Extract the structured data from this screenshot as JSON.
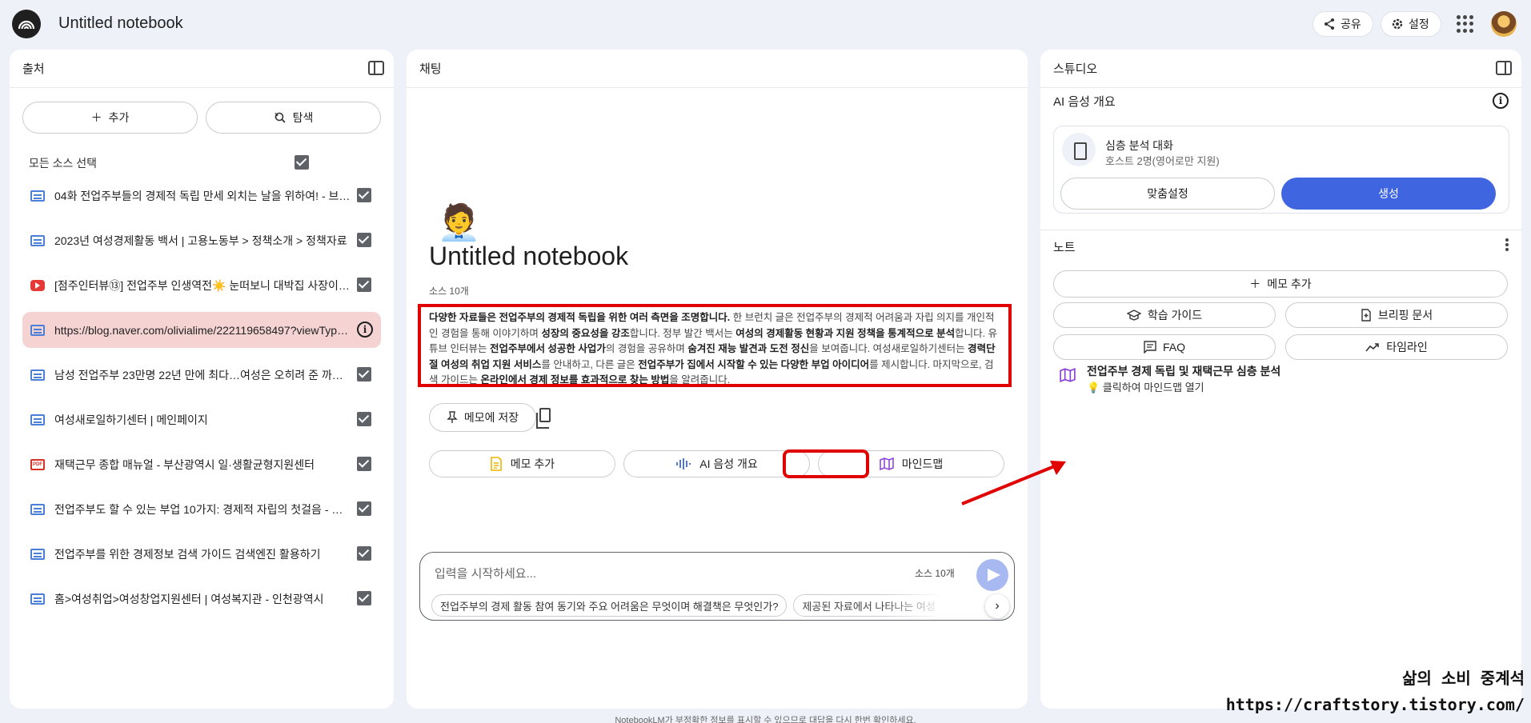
{
  "header": {
    "title": "Untitled notebook",
    "share_label": "공유",
    "settings_label": "설정"
  },
  "sources": {
    "panel_title": "출처",
    "add_label": "추가",
    "explore_label": "탐색",
    "select_all_label": "모든 소스 선택",
    "items": [
      {
        "type": "web",
        "label": "04화 전업주부들의 경제적 독립 만세 외치는 날을 위하여! - 브런치"
      },
      {
        "type": "web",
        "label": "2023년 여성경제활동 백서 | 고용노동부 > 정책소개 > 정책자료"
      },
      {
        "type": "youtube",
        "label": "[점주인터뷰⑬] 전업주부 인생역전☀️ 눈떠보니 대박집 사장이 되었다"
      },
      {
        "type": "web",
        "label": "https://blog.naver.com/olivialime/222119658497?viewType=pc"
      },
      {
        "type": "web",
        "label": "남성 전업주부 23만명 22년 만에 최다…여성은 오히려 준 까닭 - 중앙일보"
      },
      {
        "type": "web",
        "label": "여성새로일하기센터 | 메인페이지"
      },
      {
        "type": "pdf",
        "label": "재택근무 종합 매뉴얼 - 부산광역시 일·생활균형지원센터"
      },
      {
        "type": "web",
        "label": "전업주부도 할 수 있는 부업 10가지: 경제적 자립의 첫걸음 - 일상"
      },
      {
        "type": "web",
        "label": "전업주부를 위한 경제정보 검색 가이드 검색엔진 활용하기"
      },
      {
        "type": "web",
        "label": "홈>여성취업>여성창업지원센터 | 여성복지관 - 인천광역시"
      }
    ]
  },
  "chat": {
    "panel_title": "채팅",
    "emoji": "🧑‍💼",
    "notebook_title": "Untitled notebook",
    "source_count": "소스 10개",
    "summary": [
      {
        "b": true,
        "t": "다양한 자료들은 전업주부의 경제적 독립을 위한 여러 측면을 조명합니다."
      },
      {
        "b": false,
        "t": " 한 브런치 글은 전업주부의 경제적 어려움과 자립 의지를 개인적인 경험을 통해 이야기하며 "
      },
      {
        "b": true,
        "t": "성장의 중요성을 강조"
      },
      {
        "b": false,
        "t": "합니다. 정부 발간 백서는 "
      },
      {
        "b": true,
        "t": "여성의 경제활동 현황과 지원 정책을 통계적으로 분석"
      },
      {
        "b": false,
        "t": "합니다. 유튜브 인터뷰는 "
      },
      {
        "b": true,
        "t": "전업주부에서 성공한 사업가"
      },
      {
        "b": false,
        "t": "의 경험을 공유하며 "
      },
      {
        "b": true,
        "t": "숨겨진 재능 발견과 도전 정신"
      },
      {
        "b": false,
        "t": "을 보여줍니다. 여성새로일하기센터는 "
      },
      {
        "b": true,
        "t": "경력단절 여성의 취업 지원 서비스"
      },
      {
        "b": false,
        "t": "를 안내하고, 다른 글은 "
      },
      {
        "b": true,
        "t": "전업주부가 집에서 시작할 수 있는 다양한 부업 아이디어"
      },
      {
        "b": false,
        "t": "를 제시합니다. 마지막으로, 검색 가이드는 "
      },
      {
        "b": true,
        "t": "온라인에서 경제 정보를 효과적으로 찾는 방법"
      },
      {
        "b": false,
        "t": "을 알려줍니다."
      }
    ],
    "save_memo_label": "메모에 저장",
    "action_add_memo": "메모 추가",
    "action_audio": "AI 음성 개요",
    "action_mindmap": "마인드맵",
    "input_placeholder": "입력을 시작하세요...",
    "input_source_count": "소스 10개",
    "suggestions": [
      "전업주부의 경제 활동 참여 동기와 주요 어려움은 무엇이며 해결책은 무엇인가?",
      "제공된 자료에서 나타나는 여성"
    ],
    "disclaimer": "NotebookLM가 부정확한 정보를 표시할 수 있으므로 대답을 다시 한번 확인하세요."
  },
  "studio": {
    "panel_title": "스튜디오",
    "audio_section_label": "AI 음성 개요",
    "audio_title": "심층 분석 대화",
    "audio_subtitle": "호스트 2명(영어로만 지원)",
    "customize_label": "맞춤설정",
    "generate_label": "생성",
    "notes_label": "노트",
    "add_memo_label": "메모 추가",
    "study_guide_label": "학습 가이드",
    "briefing_label": "브리핑 문서",
    "faq_label": "FAQ",
    "timeline_label": "타임라인",
    "mindmap_note_title": "전업주부 경제 독립 및 재택근무 심층 분석",
    "mindmap_note_sub": "💡 클릭하여 마인드맵 열기"
  },
  "watermark": {
    "line1": "삶의 소비 중계석",
    "line2": "https://craftstory.tistory.com/"
  },
  "colors": {
    "accent": "#3f66e0",
    "highlight_border": "#e00000",
    "highlight_row": "#f5d3d3"
  }
}
